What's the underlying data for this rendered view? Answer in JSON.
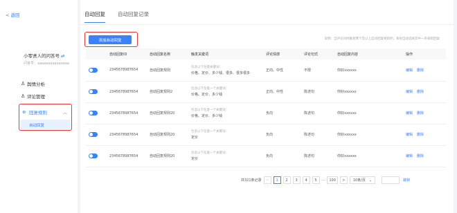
{
  "sidebar": {
    "back_label": "返回",
    "account_name": "小零贤人的问答号",
    "account_sub": "问答号：aaaaaaaaaaaaaaa",
    "items": [
      {
        "label": "舆情分析"
      },
      {
        "label": "评论管理"
      },
      {
        "label": "回复规则"
      }
    ],
    "sub_item": "自动回复"
  },
  "tabs": [
    {
      "label": "自动回复"
    },
    {
      "label": "自动回复记录"
    }
  ],
  "toolbar": {
    "add_label": "添加自动回复",
    "hint": "说明：当评论同时触发两个及以上自动回复规则时，系统自动选择其中一条规则回复"
  },
  "table": {
    "headers": [
      "",
      "自动回复ID",
      "自动回复名称",
      "触发关键词",
      "评论情感",
      "评论句式",
      "自动回复内容",
      "操作"
    ],
    "rows": [
      {
        "id": "2345678987654",
        "name": "自动回复规则",
        "kw_hint": "包含以下任意关键词：",
        "kw": "价格、定价、多少钱、很多、很多很多",
        "sentiment": "正向、中性",
        "sentence": "不限",
        "content": "你好xxxxxx"
      },
      {
        "id": "2345678987654",
        "name": "自动回复规则2",
        "kw_hint": "包含以下任意一个关键词：",
        "kw": "价格、定价、多少钱",
        "sentiment": "正向、中性",
        "sentence": "陈述句",
        "content": "你好xxxxxx"
      },
      {
        "id": "2345678987654",
        "name": "自动回复规则20",
        "kw_hint": "包含以下任意一个关键词：",
        "kw": "价格、定价、多少钱",
        "sentiment": "负向",
        "sentence": "陈述句",
        "content": "你好xxxxxx"
      },
      {
        "id": "2345678987654",
        "name": "自动回复规则20",
        "kw_hint": "包含以下任意一个关键词：",
        "kw": "定价",
        "sentiment": "负向",
        "sentence": "陈述句",
        "content": "你好xxxxxx"
      },
      {
        "id": "2345678987654",
        "name": "自动回复规则20",
        "kw_hint": "包含以下任意一个关键词：",
        "kw": "定价",
        "sentiment": "负向",
        "sentence": "陈述句",
        "content": "你好xxxxxx"
      }
    ],
    "op_edit": "编辑",
    "op_delete": "删除"
  },
  "pagination": {
    "total": "共321条记录",
    "prev": "<",
    "pages": [
      "1",
      "2",
      "3",
      "4",
      "5",
      "···",
      "100"
    ],
    "next": ">",
    "page_size": "10条/页",
    "jump_label": "跳转"
  },
  "colors": {
    "accent": "#3b82f6",
    "highlight": "#e53935"
  }
}
